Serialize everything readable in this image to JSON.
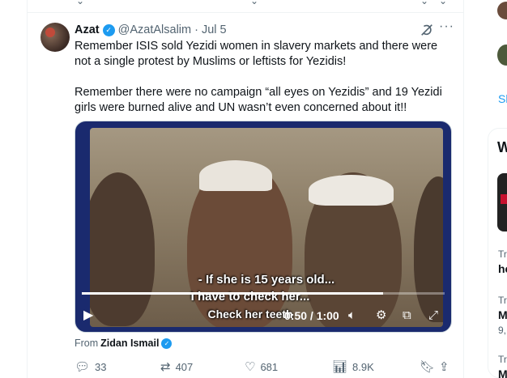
{
  "tweet": {
    "author_name": "Azat",
    "handle": "@AzatAlsalim",
    "separator": "·",
    "date": "Jul 5",
    "text": "Remember ISIS sold Yezidi women in slavery markets and there were not a single protest by Muslims or leftists for Yezidis!\n\nRemember there were no campaign “all eyes on Yezidis” and 19 Yezidi girls were burned alive and UN wasn’t even concerned about it!!"
  },
  "video": {
    "subtitle_line1": "- If she is 15 years old...",
    "subtitle_line2": "I have to check her...",
    "subtitle_line3": "Check her teeth",
    "time": "0:50 / 1:00",
    "progress": 0.83
  },
  "attribution": {
    "prefix": "From",
    "name": "Zidan Ismail"
  },
  "actions": {
    "replies": "33",
    "reposts": "407",
    "likes": "681",
    "views": "8.9K"
  },
  "sidebar": {
    "show_more_partial": "Sh",
    "section_initial": "W",
    "trend1_label": "Tr",
    "trend1_title": "he",
    "trend2_label": "Tr",
    "trend2_title": "M",
    "trend2_meta": "9,",
    "trend3_label": "Tr",
    "trend3_title": "M"
  },
  "colors": {
    "accent": "#1d9bf0",
    "text": "#0f1419",
    "muted": "#536471",
    "border": "#eff3f4"
  }
}
